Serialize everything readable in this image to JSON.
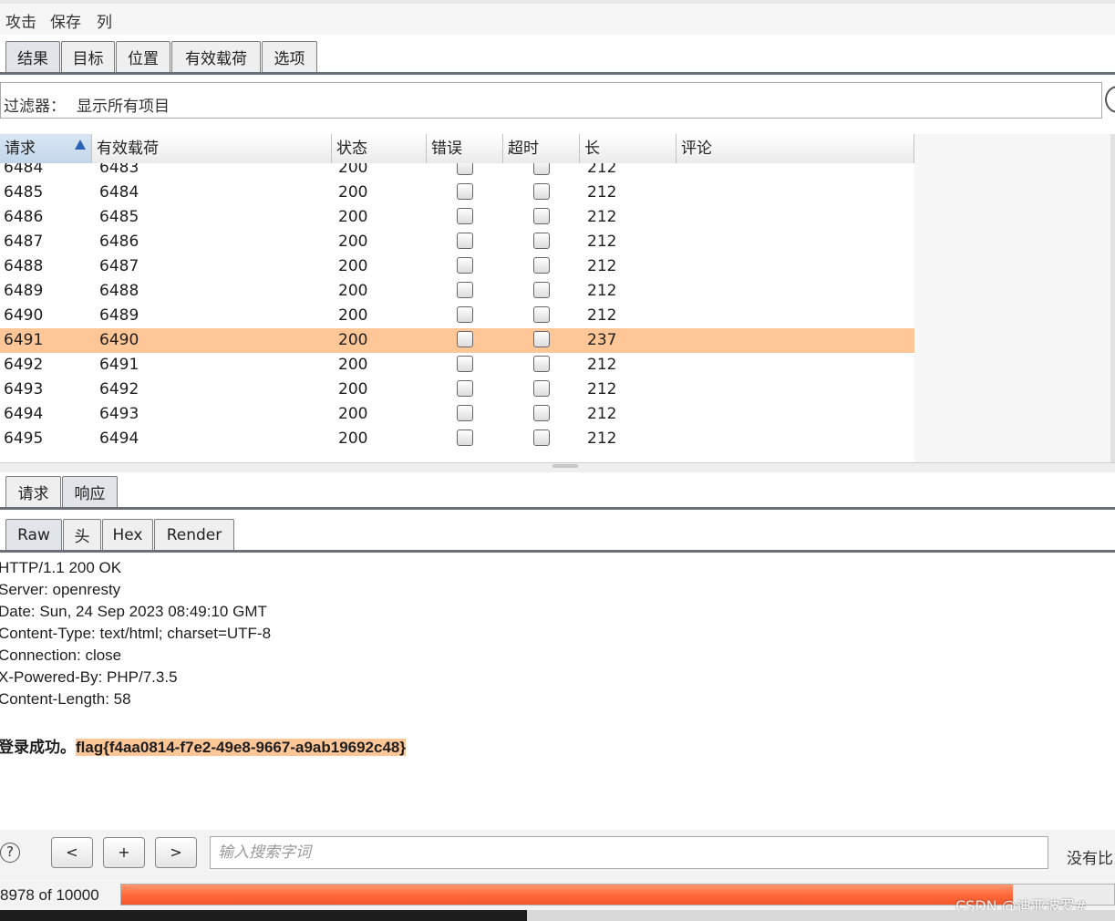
{
  "menu": {
    "items": [
      "攻击",
      "保存",
      "列"
    ]
  },
  "top_tabs": [
    "结果",
    "目标",
    "位置",
    "有效载荷",
    "选项"
  ],
  "filter": {
    "label": "过滤器：",
    "value": "显示所有项目"
  },
  "table": {
    "columns": [
      "请求",
      "有效载荷",
      "状态",
      "错误",
      "超时",
      "长",
      "评论"
    ],
    "sorted_column": "请求",
    "rows": [
      {
        "request": "6484",
        "payload": "6483",
        "status": "200",
        "length": "212",
        "highlight": false
      },
      {
        "request": "6485",
        "payload": "6484",
        "status": "200",
        "length": "212",
        "highlight": false
      },
      {
        "request": "6486",
        "payload": "6485",
        "status": "200",
        "length": "212",
        "highlight": false
      },
      {
        "request": "6487",
        "payload": "6486",
        "status": "200",
        "length": "212",
        "highlight": false
      },
      {
        "request": "6488",
        "payload": "6487",
        "status": "200",
        "length": "212",
        "highlight": false
      },
      {
        "request": "6489",
        "payload": "6488",
        "status": "200",
        "length": "212",
        "highlight": false
      },
      {
        "request": "6490",
        "payload": "6489",
        "status": "200",
        "length": "212",
        "highlight": false
      },
      {
        "request": "6491",
        "payload": "6490",
        "status": "200",
        "length": "237",
        "highlight": true
      },
      {
        "request": "6492",
        "payload": "6491",
        "status": "200",
        "length": "212",
        "highlight": false
      },
      {
        "request": "6493",
        "payload": "6492",
        "status": "200",
        "length": "212",
        "highlight": false
      },
      {
        "request": "6494",
        "payload": "6493",
        "status": "200",
        "length": "212",
        "highlight": false
      },
      {
        "request": "6495",
        "payload": "6494",
        "status": "200",
        "length": "212",
        "highlight": false
      }
    ]
  },
  "message_tabs": [
    "请求",
    "响应"
  ],
  "view_tabs": [
    "Raw",
    "头",
    "Hex",
    "Render"
  ],
  "response": {
    "headers": [
      "HTTP/1.1 200 OK",
      "Server: openresty",
      "Date: Sun, 24 Sep 2023 08:49:10 GMT",
      "Content-Type: text/html; charset=UTF-8",
      "Connection: close",
      "X-Powered-By: PHP/7.3.5",
      "Content-Length: 58"
    ],
    "body_prefix": "登录成功。",
    "flag": "flag{f4aa0814-f7e2-49e8-9667-a9ab19692c48}"
  },
  "search": {
    "help": "?",
    "prev": "<",
    "add": "+",
    "next": ">",
    "placeholder": "输入搜索字词",
    "status": "没有比"
  },
  "progress": {
    "label": "8978 of 10000",
    "done": 8978,
    "total": 10000
  },
  "watermark": "CSDN @迪亚波罗#",
  "colors": {
    "highlight": "#ffc697",
    "progress": "#ff6a3c",
    "selected_header": "#c3d6ea"
  }
}
